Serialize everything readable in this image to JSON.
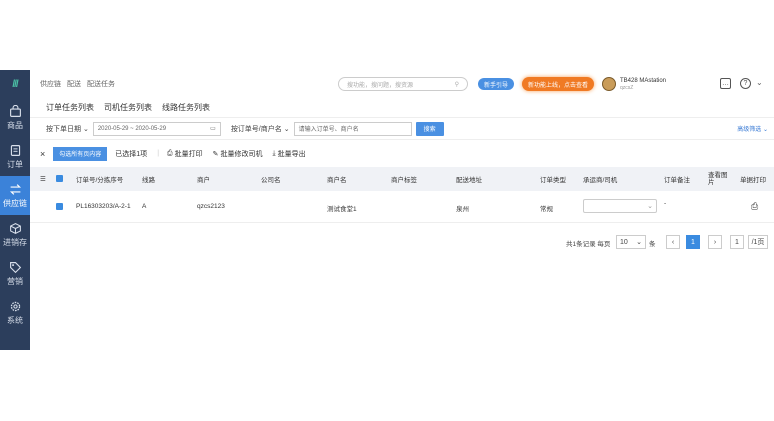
{
  "sidebar": {
    "logo": "///",
    "items": [
      {
        "label": "商品",
        "icon": "bag-icon",
        "active": false
      },
      {
        "label": "订单",
        "icon": "doc-icon",
        "active": false
      },
      {
        "label": "供应链",
        "icon": "swap-icon",
        "active": true
      },
      {
        "label": "进销存",
        "icon": "cube-icon",
        "active": false
      },
      {
        "label": "营销",
        "icon": "tag-icon",
        "active": false
      },
      {
        "label": "系统",
        "icon": "gear-icon",
        "active": false
      }
    ]
  },
  "breadcrumb": [
    "供应链",
    "配送",
    "配送任务"
  ],
  "header": {
    "search_placeholder": "搜功能，搜问题，搜资源",
    "guide_label": "新手引导",
    "new_feature_label": "新功能上线，点击查看",
    "user_name": "TB428 MAstation",
    "user_sub": "qzcsZ"
  },
  "tabs": [
    "订单任务列表",
    "司机任务列表",
    "线路任务列表"
  ],
  "filters": {
    "date_type": "按下单日期",
    "date_range": "2020-05-29 ~ 2020-05-29",
    "search_type": "按订单号/商户名",
    "search_placeholder": "请输入订单号、商户名",
    "search_button": "搜索",
    "advanced": "高级筛选"
  },
  "actions": {
    "close": "×",
    "select_all": "勾选所有页内容",
    "selected": "已选择1项",
    "batch_print": "批量打印",
    "batch_edit_driver": "批量修改司机",
    "batch_export": "批量导出"
  },
  "table": {
    "headers": [
      "订单号/分拣序号",
      "线路",
      "商户",
      "公司名",
      "商户名",
      "商户标签",
      "配送地址",
      "订单类型",
      "承运商/司机",
      "订单备注",
      "查看图片",
      "单据打印"
    ],
    "rows": [
      {
        "order": "PL16303203/A-2-1",
        "route": "A",
        "merchant": "qzcs2123",
        "company": "",
        "merchant_name": "测试食堂1",
        "tag": "",
        "address": "泉州",
        "type": "常规",
        "driver": "",
        "note": "-",
        "image": "",
        "print": "printer-icon"
      }
    ]
  },
  "pager": {
    "summary": "共1条记录 每页",
    "page_size": "10",
    "unit": "条",
    "prev": "‹",
    "current": "1",
    "next": "›",
    "jump_value": "1",
    "total_pages": "/1页"
  },
  "colors": {
    "sidebar": "#2c3e5c",
    "active": "#3b82d9",
    "primary": "#4a90e2",
    "orange": "#f07a24"
  }
}
